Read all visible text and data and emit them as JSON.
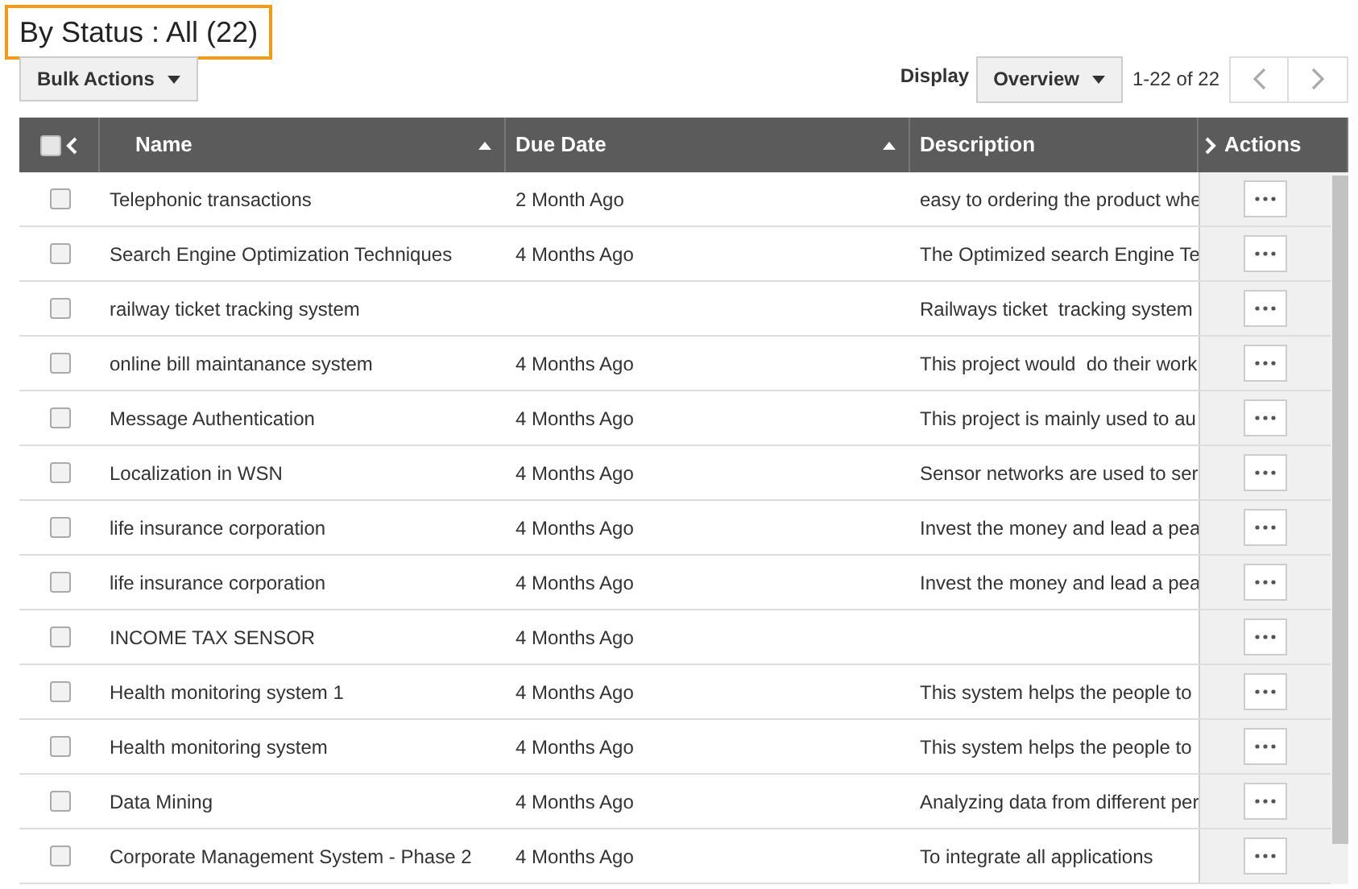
{
  "title": "By Status : All (22)",
  "toolbar": {
    "bulk_actions": "Bulk Actions",
    "display_label": "Display",
    "display_value": "Overview",
    "range": "1-22 of 22"
  },
  "table": {
    "select_all": {
      "checked": false
    },
    "columns": [
      {
        "label": "Name",
        "sortable": true
      },
      {
        "label": "Due Date",
        "sortable": true
      },
      {
        "label": "Description",
        "sortable": false
      },
      {
        "label": "Actions",
        "sortable": false
      }
    ],
    "rows": [
      {
        "name": "Telephonic transactions",
        "due": "2 Month Ago",
        "description": "easy to ordering the product whe",
        "checked": false
      },
      {
        "name": "Search Engine Optimization Techniques",
        "due": "4 Months Ago",
        "description": "The Optimized search Engine Te",
        "checked": false
      },
      {
        "name": "railway ticket tracking system",
        "due": "",
        "description": "Railways ticket  tracking system",
        "checked": false
      },
      {
        "name": "online bill maintanance system",
        "due": "4 Months Ago",
        "description": "This project would  do their work",
        "checked": false
      },
      {
        "name": "Message Authentication",
        "due": "4 Months Ago",
        "description": "This project is mainly used to au",
        "checked": false
      },
      {
        "name": "Localization in WSN",
        "due": "4 Months Ago",
        "description": "Sensor networks are used to ser",
        "checked": false
      },
      {
        "name": "life insurance corporation",
        "due": "4 Months Ago",
        "description": "Invest the money and lead a pea",
        "checked": false
      },
      {
        "name": "life insurance corporation",
        "due": "4 Months Ago",
        "description": "Invest the money and lead a pea",
        "checked": false
      },
      {
        "name": "INCOME TAX SENSOR",
        "due": "4 Months Ago",
        "description": "",
        "checked": false
      },
      {
        "name": "Health monitoring system 1",
        "due": "4 Months Ago",
        "description": "This system helps the people to",
        "checked": false
      },
      {
        "name": "Health monitoring system",
        "due": "4 Months Ago",
        "description": "This system helps the people to",
        "checked": false
      },
      {
        "name": "Data Mining",
        "due": "4 Months Ago",
        "description": "Analyzing data from different per",
        "checked": false
      },
      {
        "name": "Corporate Management System - Phase 2",
        "due": "4 Months Ago",
        "description": "To integrate all applications",
        "checked": false
      }
    ]
  }
}
